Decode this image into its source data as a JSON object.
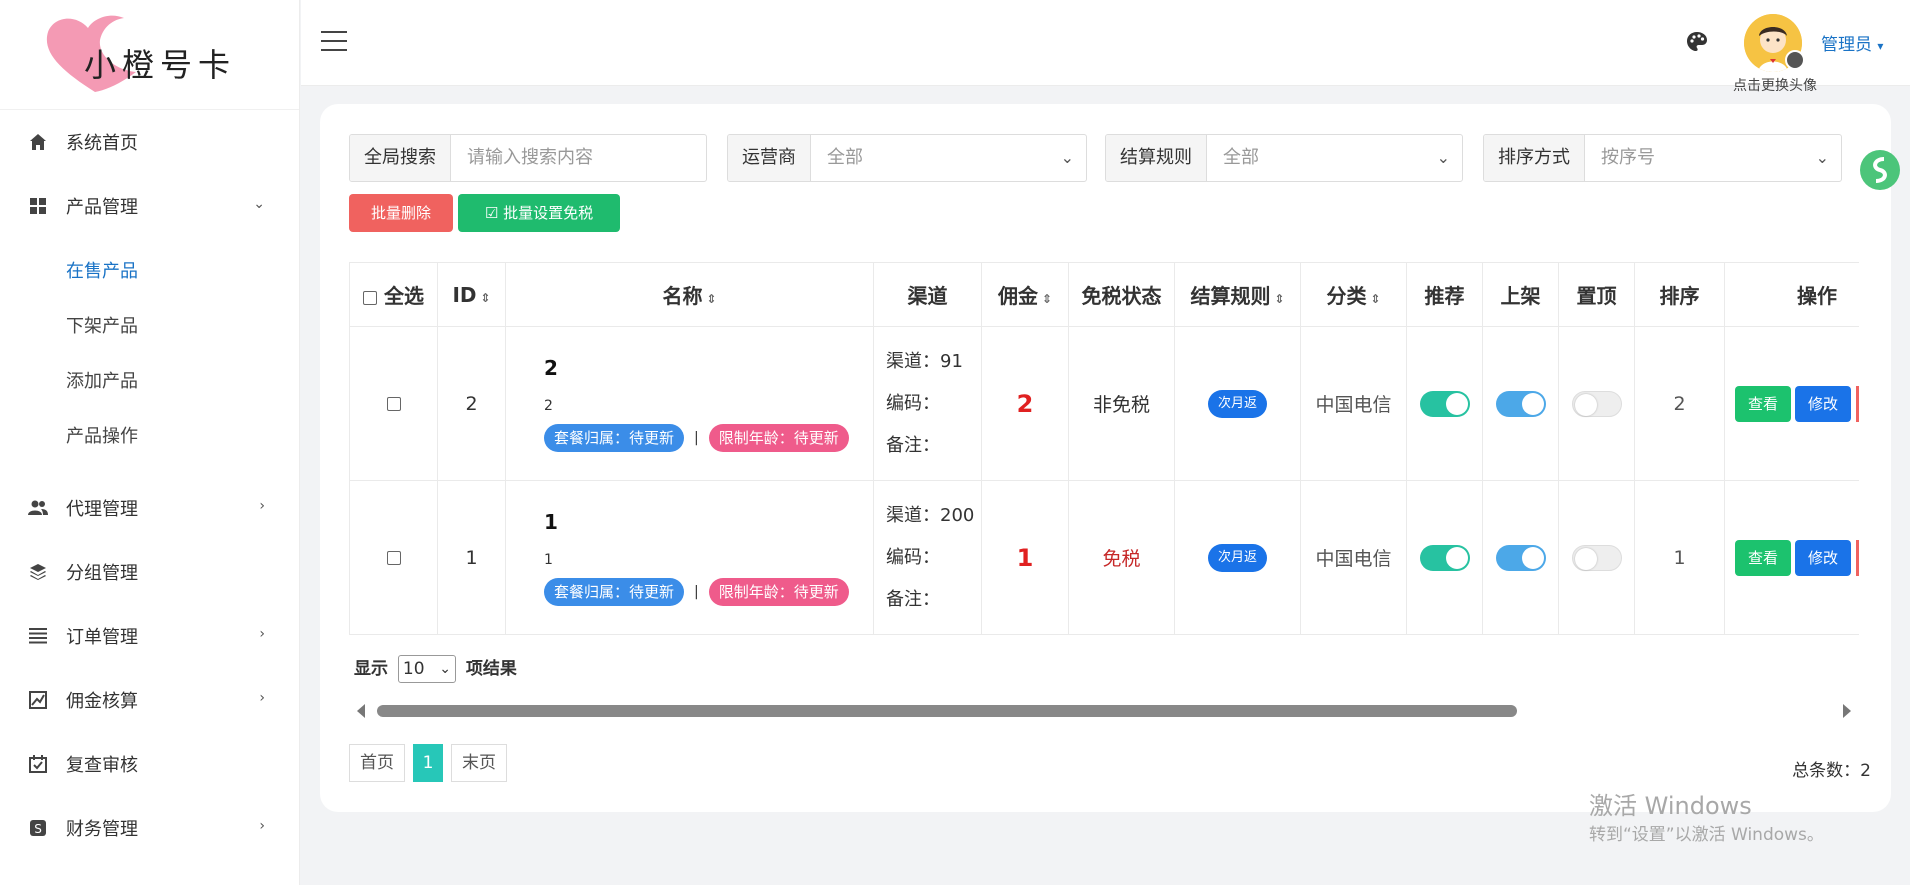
{
  "brand": {
    "name": "小橙号卡"
  },
  "sidebar": {
    "items": [
      {
        "label": "系统首页",
        "icon": "home-icon"
      },
      {
        "label": "产品管理",
        "icon": "grid-icon"
      },
      {
        "label": "代理管理",
        "icon": "users-icon"
      },
      {
        "label": "分组管理",
        "icon": "layers-icon"
      },
      {
        "label": "订单管理",
        "icon": "list-icon"
      },
      {
        "label": "佣金核算",
        "icon": "chart-icon"
      },
      {
        "label": "复查审核",
        "icon": "check-calendar-icon"
      },
      {
        "label": "财务管理",
        "icon": "dollar-icon"
      }
    ],
    "sub_items": [
      "在售产品",
      "下架产品",
      "添加产品",
      "产品操作"
    ]
  },
  "header": {
    "avatar_tip": "点击更换头像",
    "user": "管理员"
  },
  "filters": {
    "search_label": "全局搜索",
    "search_placeholder": "请输入搜索内容",
    "carrier_label": "运营商",
    "carrier_value": "全部",
    "settle_label": "结算规则",
    "settle_value": "全部",
    "sort_label": "排序方式",
    "sort_value": "按序号"
  },
  "actions": {
    "batch_delete": "批量删除",
    "batch_tax": "批量设置免税"
  },
  "table": {
    "headers": {
      "select_all": "全选",
      "id": "ID",
      "name": "名称",
      "channel": "渠道",
      "commission": "佣金",
      "tax": "免税状态",
      "settle": "结算规则",
      "category": "分类",
      "recommend": "推荐",
      "shelf": "上架",
      "top": "置顶",
      "order": "排序",
      "ops": "操作"
    },
    "rows": [
      {
        "id": "2",
        "title": "2",
        "subtitle": "2",
        "tag1": "套餐归属：待更新",
        "tag2": "限制年龄：待更新",
        "sep": "|",
        "channel": "渠道：91",
        "code": "编码：",
        "remark": "备注：",
        "commission": "2",
        "tax": "非免税",
        "settle": "次月返",
        "category": "中国电信",
        "order": "2",
        "view": "查看",
        "edit": "修改",
        "recommend": true,
        "shelf": true,
        "top": false
      },
      {
        "id": "1",
        "title": "1",
        "subtitle": "1",
        "tag1": "套餐归属：待更新",
        "tag2": "限制年龄：待更新",
        "sep": "|",
        "channel": "渠道：200",
        "code": "编码：",
        "remark": "备注：",
        "commission": "1",
        "tax": "免税",
        "settle": "次月返",
        "category": "中国电信",
        "order": "1",
        "view": "查看",
        "edit": "修改",
        "recommend": true,
        "shelf": true,
        "top": false
      }
    ]
  },
  "footer": {
    "show_prefix": "显示",
    "page_size": "10",
    "show_suffix": "项结果",
    "first": "首页",
    "current_page": "1",
    "last": "末页",
    "total": "总条数：2"
  },
  "watermark": {
    "line1": "激活 Windows",
    "line2": "转到“设置”以激活 Windows。"
  },
  "colors": {
    "accent": "#1a73c6",
    "danger": "#f0625f",
    "success": "#1fbb6e",
    "pager_active": "#27c7b8"
  }
}
